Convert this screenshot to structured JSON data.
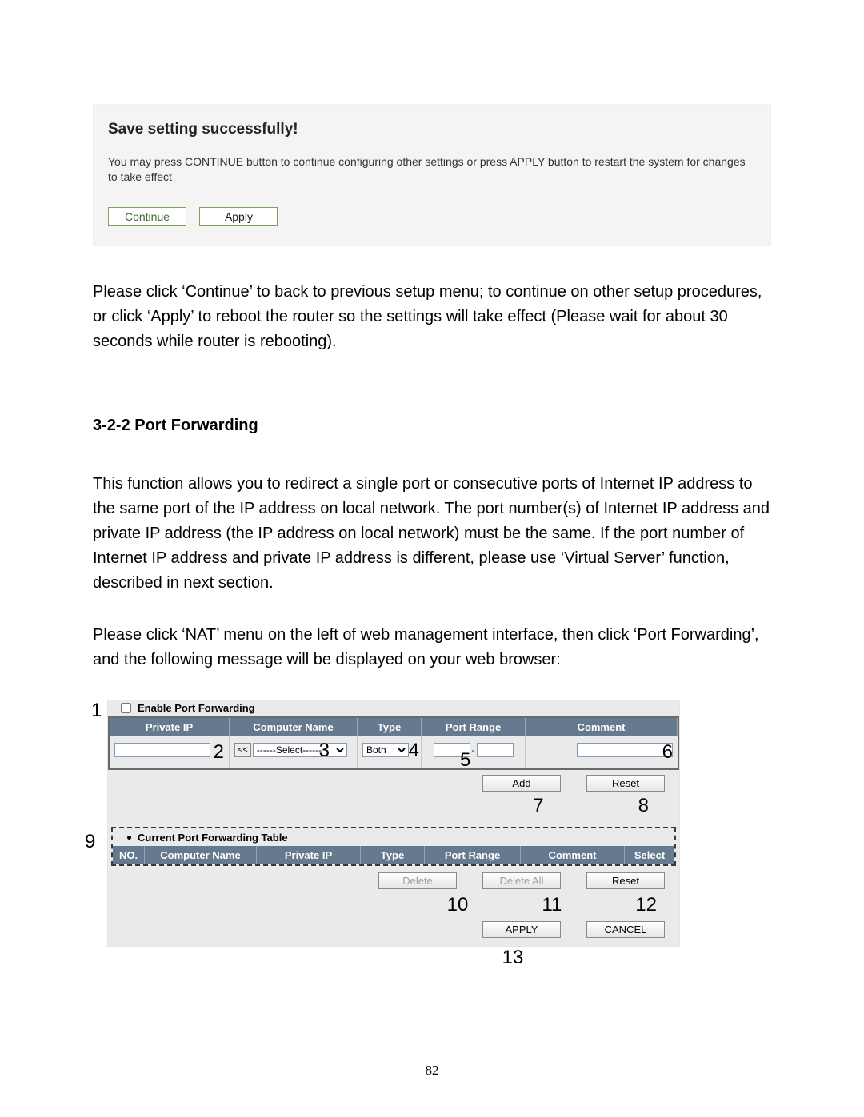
{
  "save_panel": {
    "title": "Save setting successfully!",
    "message": "You may press CONTINUE button to continue configuring other settings or press APPLY button to restart the system for changes to take effect",
    "continue_label": "Continue",
    "apply_label": "Apply"
  },
  "body_text_1": "Please click ‘Continue’ to back to previous setup menu; to continue on other setup procedures, or click ‘Apply’ to reboot the router so the settings will take effect (Please wait for about 30 seconds while router is rebooting).",
  "section_heading": "3-2-2 Port Forwarding",
  "body_text_2": "This function allows you to redirect a single port or consecutive ports of Internet IP address to the same port of the IP address on local network. The port number(s) of Internet IP address and private IP address (the IP address on local network) must be the same. If the port number of Internet IP address and private IP address is different, please use ‘Virtual Server’ function, described in next section.",
  "body_text_3": "Please click ‘NAT’ menu on the left of web management interface, then click ‘Port Forwarding’, and the following message will be displayed on your web browser:",
  "pf": {
    "enable_label": "Enable Port Forwarding",
    "headers": {
      "private_ip": "Private IP",
      "computer_name": "Computer Name",
      "type": "Type",
      "port_range": "Port Range",
      "comment": "Comment"
    },
    "computer_name_copy": "<<",
    "computer_name_select": "------Select------",
    "type_value": "Both",
    "port_dash": "-",
    "add_label": "Add",
    "reset_label": "Reset",
    "current_title": "Current Port Forwarding Table",
    "cur_headers": {
      "no": "NO.",
      "computer_name": "Computer Name",
      "private_ip": "Private IP",
      "type": "Type",
      "port_range": "Port Range",
      "comment": "Comment",
      "select": "Select"
    },
    "delete_label": "Delete",
    "delete_all_label": "Delete All",
    "apply_label": "APPLY",
    "cancel_label": "CANCEL"
  },
  "callouts": {
    "n1": "1",
    "n2": "2",
    "n3": "3",
    "n4": "4",
    "n5": "5",
    "n6": "6",
    "n7": "7",
    "n8": "8",
    "n9": "9",
    "n10": "10",
    "n11": "11",
    "n12": "12",
    "n13": "13"
  },
  "page_number": "82"
}
